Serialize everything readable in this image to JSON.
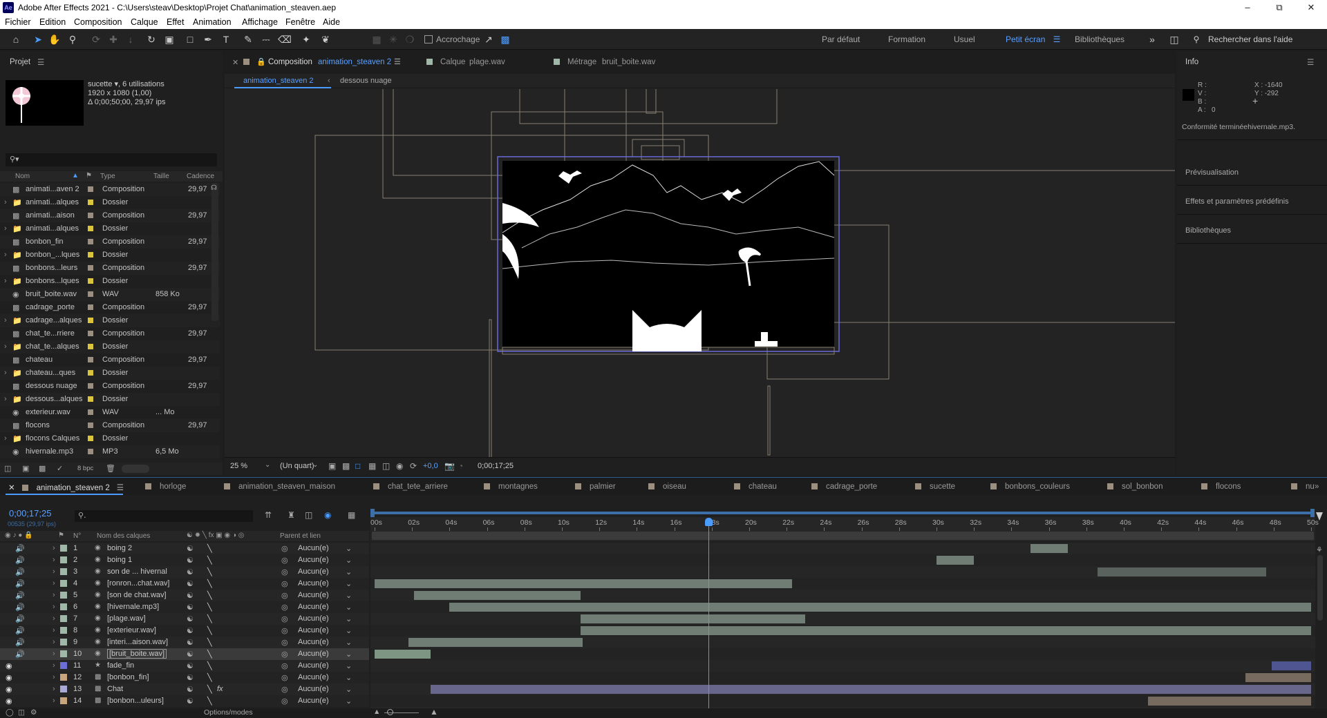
{
  "window": {
    "app_icon": "Ae",
    "title": "Adobe After Effects 2021 - C:\\Users\\steav\\Desktop\\Projet Chat\\animation_steaven.aep",
    "controls": [
      "minimize-icon",
      "restore-icon",
      "close-icon"
    ]
  },
  "menu": [
    "Fichier",
    "Edition",
    "Composition",
    "Calque",
    "Effet",
    "Animation",
    "Affichage",
    "Fenêtre",
    "Aide"
  ],
  "toolbar": {
    "snapping_label": "Accrochage",
    "workspaces": [
      "Par défaut",
      "Formation",
      "Usuel",
      "Petit écran",
      "Bibliothèques"
    ],
    "active_workspace": "Petit écran",
    "search_placeholder": "Rechercher dans l'aide"
  },
  "project": {
    "title": "Projet",
    "selected": {
      "name": "sucette ▾",
      "usage": ", 6 utilisations",
      "line2": "1920 x 1080 (1,00)",
      "line3": "Δ 0;00;50;00, 29,97 ips"
    },
    "columns": {
      "name": "Nom",
      "type": "Type",
      "size": "Taille",
      "rate": "Cadence"
    },
    "items": [
      {
        "name": "animati...aven 2",
        "type": "Composition",
        "size": "",
        "rate": "29,97",
        "color": "#9a8f80",
        "kind": "comp"
      },
      {
        "name": "animati...alques",
        "type": "Dossier",
        "size": "",
        "rate": "",
        "color": "#d9c43c",
        "kind": "folder"
      },
      {
        "name": "animati...aison",
        "type": "Composition",
        "size": "",
        "rate": "29,97",
        "color": "#9a8f80",
        "kind": "comp"
      },
      {
        "name": "animati...alques",
        "type": "Dossier",
        "size": "",
        "rate": "",
        "color": "#d9c43c",
        "kind": "folder"
      },
      {
        "name": "bonbon_fin",
        "type": "Composition",
        "size": "",
        "rate": "29,97",
        "color": "#9a8f80",
        "kind": "comp"
      },
      {
        "name": "bonbon_...lques",
        "type": "Dossier",
        "size": "",
        "rate": "",
        "color": "#d9c43c",
        "kind": "folder"
      },
      {
        "name": "bonbons...leurs",
        "type": "Composition",
        "size": "",
        "rate": "29,97",
        "color": "#9a8f80",
        "kind": "comp"
      },
      {
        "name": "bonbons...lques",
        "type": "Dossier",
        "size": "",
        "rate": "",
        "color": "#d9c43c",
        "kind": "folder"
      },
      {
        "name": "bruit_boite.wav",
        "type": "WAV",
        "size": "858 Ko",
        "rate": "",
        "color": "#9a8f80",
        "kind": "audio"
      },
      {
        "name": "cadrage_porte",
        "type": "Composition",
        "size": "",
        "rate": "29,97",
        "color": "#9a8f80",
        "kind": "comp"
      },
      {
        "name": "cadrage...alques",
        "type": "Dossier",
        "size": "",
        "rate": "",
        "color": "#d9c43c",
        "kind": "folder"
      },
      {
        "name": "chat_te...rriere",
        "type": "Composition",
        "size": "",
        "rate": "29,97",
        "color": "#9a8f80",
        "kind": "comp"
      },
      {
        "name": "chat_te...alques",
        "type": "Dossier",
        "size": "",
        "rate": "",
        "color": "#d9c43c",
        "kind": "folder"
      },
      {
        "name": "chateau",
        "type": "Composition",
        "size": "",
        "rate": "29,97",
        "color": "#9a8f80",
        "kind": "comp"
      },
      {
        "name": "chateau...ques",
        "type": "Dossier",
        "size": "",
        "rate": "",
        "color": "#d9c43c",
        "kind": "folder"
      },
      {
        "name": "dessous nuage",
        "type": "Composition",
        "size": "",
        "rate": "29,97",
        "color": "#9a8f80",
        "kind": "comp"
      },
      {
        "name": "dessous...alques",
        "type": "Dossier",
        "size": "",
        "rate": "",
        "color": "#d9c43c",
        "kind": "folder"
      },
      {
        "name": "exterieur.wav",
        "type": "WAV",
        "size": "... Mo",
        "rate": "",
        "color": "#9a8f80",
        "kind": "audio"
      },
      {
        "name": "flocons",
        "type": "Composition",
        "size": "",
        "rate": "29,97",
        "color": "#9a8f80",
        "kind": "comp"
      },
      {
        "name": "flocons Calques",
        "type": "Dossier",
        "size": "",
        "rate": "",
        "color": "#d9c43c",
        "kind": "folder"
      },
      {
        "name": "hivernale.mp3",
        "type": "MP3",
        "size": "6,5 Mo",
        "rate": "",
        "color": "#9a8f80",
        "kind": "audio"
      }
    ],
    "bpc": "8 bpc"
  },
  "viewer": {
    "tabs": [
      {
        "prefix": "Composition",
        "name": "animation_steaven 2"
      },
      {
        "prefix": "Calque",
        "name": "plage.wav"
      },
      {
        "prefix": "Métrage",
        "name": "bruit_boite.wav"
      }
    ],
    "breadcrumbs": [
      "animation_steaven 2",
      "dessous nuage"
    ],
    "zoom": "25 %",
    "resolution": "(Un quart)",
    "exposure": "+0,0",
    "timecode": "0;00;17;25"
  },
  "info": {
    "title": "Info",
    "rgba_labels": [
      "R :",
      "V :",
      "B :",
      "A :"
    ],
    "alpha": "0",
    "x": "X : -1640",
    "y": "Y : -292",
    "message": "Conformité terminéehivernale.mp3.",
    "sections": [
      "Prévisualisation",
      "Effets et paramètres prédéfinis",
      "Bibliothèques"
    ]
  },
  "timeline": {
    "tabs": [
      {
        "name": "animation_steaven 2",
        "color": "#9a8f80"
      },
      {
        "name": "horloge",
        "color": "#9a8f80"
      },
      {
        "name": "animation_steaven_maison",
        "color": "#9a8f80"
      },
      {
        "name": "chat_tete_arriere",
        "color": "#9a8f80"
      },
      {
        "name": "montagnes",
        "color": "#9a8f80"
      },
      {
        "name": "palmier",
        "color": "#9a8f80"
      },
      {
        "name": "oiseau",
        "color": "#9a8f80"
      },
      {
        "name": "chateau",
        "color": "#9a8f80"
      },
      {
        "name": "cadrage_porte",
        "color": "#9a8f80"
      },
      {
        "name": "sucette",
        "color": "#9a8f80"
      },
      {
        "name": "bonbons_couleurs",
        "color": "#9a8f80"
      },
      {
        "name": "sol_bonbon",
        "color": "#9a8f80"
      },
      {
        "name": "flocons",
        "color": "#9a8f80"
      },
      {
        "name": "nu",
        "color": "#9a8f80"
      }
    ],
    "timecode": "0;00;17;25",
    "frame_info": "00535 (29,97 ips)",
    "col_num": "N°",
    "col_name": "Nom des calques",
    "col_parent": "Parent et lien",
    "ruler": [
      "00s",
      "02s",
      "04s",
      "06s",
      "08s",
      "10s",
      "12s",
      "14s",
      "16s",
      "18s",
      "20s",
      "22s",
      "24s",
      "26s",
      "28s",
      "30s",
      "32s",
      "34s",
      "36s",
      "38s",
      "40s",
      "42s",
      "44s",
      "46s",
      "48s",
      "50s"
    ],
    "duration_s": 50,
    "current_s": 17.84,
    "layers": [
      {
        "num": "1",
        "name": "boing 2",
        "parent": "Aucun(e)",
        "label": "#9fb8a8",
        "bar": [
          35,
          37
        ],
        "barcolor": "#6f7d75",
        "audio": true
      },
      {
        "num": "2",
        "name": "boing 1",
        "parent": "Aucun(e)",
        "label": "#9fb8a8",
        "bar": [
          30,
          32
        ],
        "barcolor": "#6f7d75",
        "audio": true
      },
      {
        "num": "3",
        "name": "son de ... hivernal",
        "parent": "Aucun(e)",
        "label": "#9fb8a8",
        "bar": [
          38.6,
          47.6
        ],
        "barcolor": "#5a625d",
        "audio": true
      },
      {
        "num": "4",
        "name": "[ronron...chat.wav]",
        "parent": "Aucun(e)",
        "label": "#9fb8a8",
        "bar": [
          0,
          22.3
        ],
        "barcolor": "#6f7d75",
        "audio": true
      },
      {
        "num": "5",
        "name": "[son de chat.wav]",
        "parent": "Aucun(e)",
        "label": "#9fb8a8",
        "bar": [
          2.1,
          11
        ],
        "barcolor": "#6f7d75",
        "audio": true
      },
      {
        "num": "6",
        "name": "[hivernale.mp3]",
        "parent": "Aucun(e)",
        "label": "#9fb8a8",
        "bar": [
          4,
          50
        ],
        "barcolor": "#6f7d75",
        "audio": true
      },
      {
        "num": "7",
        "name": "[plage.wav]",
        "parent": "Aucun(e)",
        "label": "#9fb8a8",
        "bar": [
          11,
          23
        ],
        "barcolor": "#6f7d75",
        "audio": true
      },
      {
        "num": "8",
        "name": "[exterieur.wav]",
        "parent": "Aucun(e)",
        "label": "#9fb8a8",
        "bar": [
          11,
          50
        ],
        "barcolor": "#6f7d75",
        "audio": true
      },
      {
        "num": "9",
        "name": "[interi...aison.wav]",
        "parent": "Aucun(e)",
        "label": "#9fb8a8",
        "bar": [
          1.8,
          11.1
        ],
        "barcolor": "#6f7d75",
        "audio": true
      },
      {
        "num": "10",
        "name": "[bruit_boite.wav]",
        "parent": "Aucun(e)",
        "label": "#9fb8a8",
        "bar": [
          0,
          3
        ],
        "barcolor": "#7f9583",
        "audio": true,
        "selected": true
      },
      {
        "num": "11",
        "name": "fade_fin",
        "parent": "Aucun(e)",
        "label": "#6e6ed8",
        "bar": [
          47.9,
          50
        ],
        "barcolor": "#4f5590",
        "audio": false
      },
      {
        "num": "12",
        "name": "[bonbon_fin]",
        "parent": "Aucun(e)",
        "label": "#c9a57e",
        "bar": [
          46.5,
          50
        ],
        "barcolor": "#766b5e",
        "audio": false
      },
      {
        "num": "13",
        "name": "Chat",
        "parent": "Aucun(e)",
        "label": "#a9a9d8",
        "bar": [
          3,
          50
        ],
        "barcolor": "#68668a",
        "audio": false
      },
      {
        "num": "14",
        "name": "[bonbon...uleurs]",
        "parent": "Aucun(e)",
        "label": "#c9a57e",
        "bar": [
          41.3,
          50
        ],
        "barcolor": "#766b5e",
        "audio": false
      }
    ],
    "footer": "Options/modes"
  }
}
